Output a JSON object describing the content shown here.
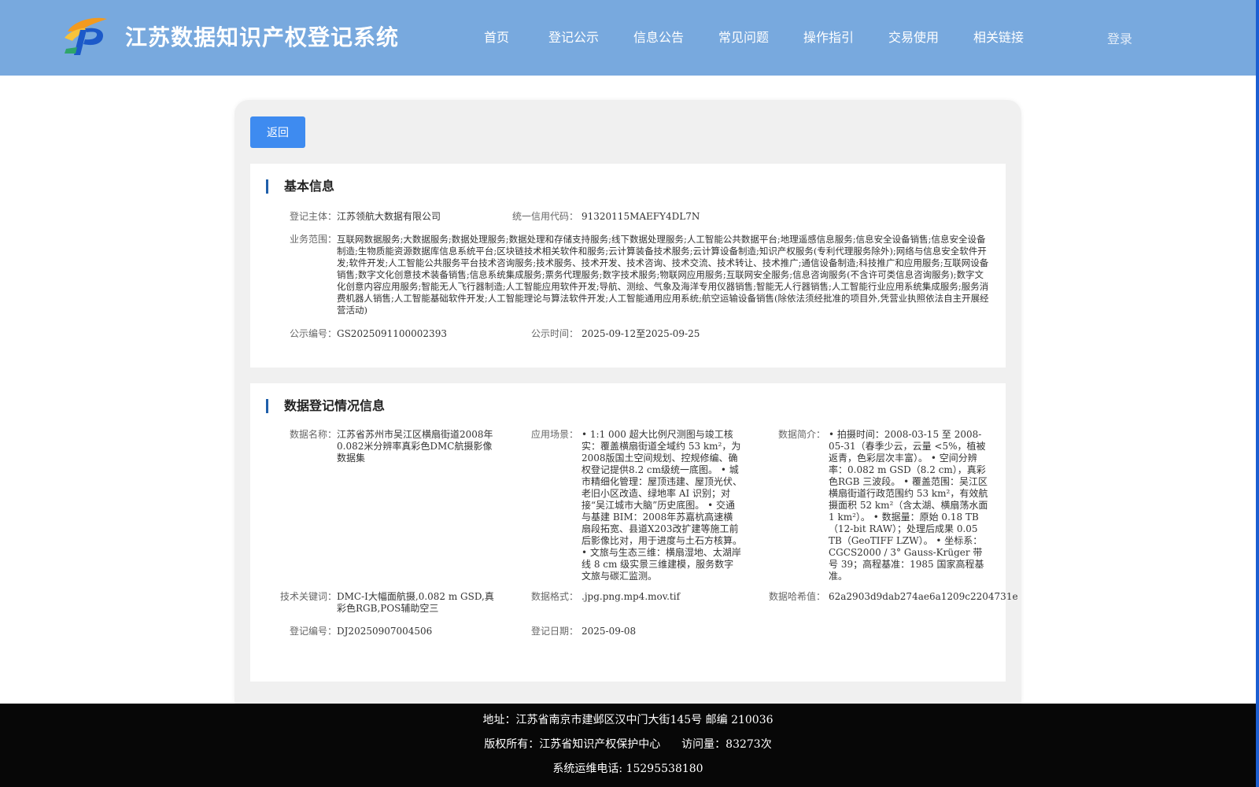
{
  "header": {
    "title": "江苏数据知识产权登记系统",
    "logo_icon": "ip-logo-icon",
    "nav": [
      "首页",
      "登记公示",
      "信息公告",
      "常见问题",
      "操作指引",
      "交易使用",
      "相关链接"
    ],
    "login": "登录"
  },
  "back_label": "返回",
  "basic": {
    "title": "基本信息",
    "subject_label": "登记主体：",
    "subject": "江苏领航大数据有限公司",
    "credit_label": "统一信用代码：",
    "credit": "91320115MAEFY4DL7N",
    "scope_label": "业务范围：",
    "scope": "互联网数据服务;大数据服务;数据处理服务;数据处理和存储支持服务;线下数据处理服务;人工智能公共数据平台;地理遥感信息服务;信息安全设备销售;信息安全设备制造;生物质能资源数据库信息系统平台;区块链技术相关软件和服务;云计算装备技术服务;云计算设备制造;知识产权服务(专利代理服务除外);网络与信息安全软件开发;软件开发;人工智能公共服务平台技术咨询服务;技术服务、技术开发、技术咨询、技术交流、技术转让、技术推广;通信设备制造;科技推广和应用服务;互联网设备销售;数字文化创意技术装备销售;信息系统集成服务;票务代理服务;数字技术服务;物联网应用服务;互联网安全服务;信息咨询服务(不含许可类信息咨询服务);数字文化创意内容应用服务;智能无人飞行器制造;人工智能应用软件开发;导航、测绘、气象及海洋专用仪器销售;智能无人行器销售;人工智能行业应用系统集成服务;服务消费机器人销售;人工智能基础软件开发;人工智能理论与算法软件开发;人工智能通用应用系统;航空运输设备销售(除依法须经批准的项目外,凭营业执照依法自主开展经营活动)",
    "pub_no_label": "公示编号：",
    "pub_no": "GS2025091100002393",
    "pub_time_label": "公示时间：",
    "pub_time": "2025-09-12至2025-09-25"
  },
  "registration": {
    "title": "数据登记情况信息",
    "name_label": "数据名称：",
    "name": "江苏省苏州市吴江区横扇街道2008年0.082米分辨率真彩色DMC航摄影像数据集",
    "scenario_label": "应用场景：",
    "scenario": "• 1:1 000 超大比例尺测图与竣工核实：覆盖横扇街道全域约 53 km²，为2008版国土空间规划、控规修编、确权登记提供8.2 cm级统一底图。 • 城市精细化管理：屋顶违建、屋顶光伏、老旧小区改造、绿地率 AI 识别；对接“吴江城市大脑”历史底图。 • 交通与基建 BIM：2008年苏嘉杭高速横扇段拓宽、县道X203改扩建等施工前后影像比对，用于进度与土石方核算。 • 文旅与生态三维：横扇湿地、太湖岸线 8 cm 级实景三维建模，服务数字文旅与碳汇监测。",
    "intro_label": "数据简介：",
    "intro": "• 拍摄时间：2008-03-15 至 2008-05-31（春季少云，云量 <5%，植被返青，色彩层次丰富）。 • 空间分辨率：0.082 m GSD（8.2 cm），真彩色RGB 三波段。 • 覆盖范围：吴江区横扇街道行政范围约 53 km²，有效航摄面积 52 km²（含太湖、横扇荡水面 1 km²）。 • 数据量：原始 0.18 TB（12-bit RAW）；处理后成果 0.05 TB（GeoTIFF LZW）。 • 坐标系：CGCS2000 / 3° Gauss-Krüger 带号 39；高程基准：1985 国家高程基准。",
    "keywords_label": "技术关键词：",
    "keywords": "DMC-I大幅面航摄,0.082 m GSD,真彩色RGB,POS辅助空三",
    "format_label": "数据格式：",
    "format": ".jpg.png.mp4.mov.tif",
    "hash_label": "数据哈希值：",
    "hash": "62a2903d9dab274ae6a1209c2204731e",
    "reg_no_label": "登记编号：",
    "reg_no": "DJ20250907004506",
    "reg_date_label": "登记日期：",
    "reg_date": "2025-09-08"
  },
  "footer": {
    "address": "地址：江苏省南京市建邺区汉中门大街145号 邮编 210036",
    "copyright": "版权所有：江苏省知识产权保护中心",
    "visits": "访问量：83273次",
    "hotline": "系统运维电话: 15295538180"
  }
}
